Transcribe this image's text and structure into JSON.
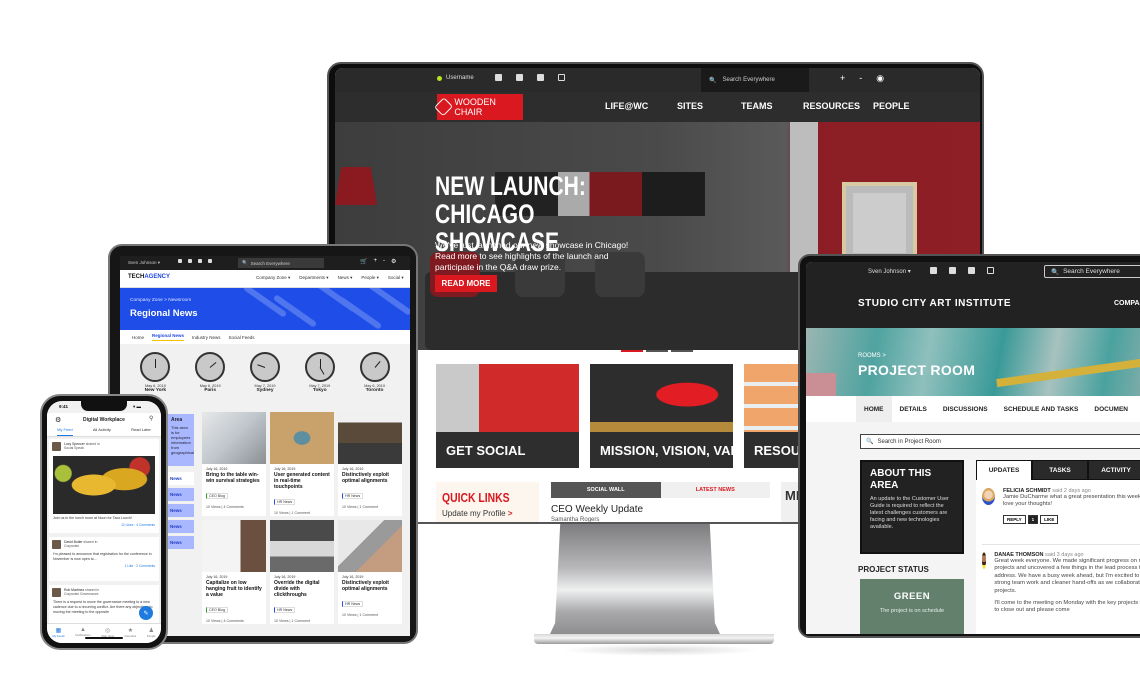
{
  "desktop": {
    "topbar": {
      "username": "Username",
      "search_placeholder": "Search Everywhere",
      "icons": [
        "chat-icon",
        "task-icon",
        "calendar-icon",
        "compose-icon"
      ],
      "right_icons": [
        "+",
        "-",
        "settings"
      ]
    },
    "nav": {
      "logo": "WOODEN CHAIR",
      "items": [
        "LIFE@WC",
        "SITES",
        "TEAMS",
        "RESOURCES",
        "PEOPLE"
      ]
    },
    "hero": {
      "title_line1": "NEW LAUNCH:",
      "title_line2": "CHICAGO SHOWCASE",
      "text": "We've just launched our new showcase in Chicago! Read more to see highlights of the launch and participate in the Q&A draw prize.",
      "button": "READ MORE",
      "slides": 3,
      "active_slide": 1
    },
    "tiles": [
      "GET SOCIAL",
      "MISSION, VISION, VALUES",
      "RESOURCES"
    ],
    "quick_links": {
      "title": "QUICK LINKS",
      "link": "Update my Profile",
      "arrow": ">"
    },
    "social_tabs": [
      "SOCIAL WALL",
      "LATEST NEWS"
    ],
    "post": {
      "title": "CEO Weekly Update",
      "author": "Samantha Rogers"
    },
    "side_box_title": "ME"
  },
  "laptop": {
    "topbar": {
      "user": "Sven Johnson ▾",
      "search_placeholder": "Search Everywhere"
    },
    "brand": "STUDIO CITY ART INSTITUTE",
    "nav_right": "COMPAN",
    "breadcrumb": "ROOMS >",
    "room_title": "PROJECT ROOM",
    "tabs": [
      "HOME",
      "DETAILS",
      "DISCUSSIONS",
      "SCHEDULE AND TASKS",
      "DOCUMEN"
    ],
    "room_search_placeholder": "Search in Project Room",
    "about": {
      "title": "ABOUT THIS AREA",
      "text": "An update to the Customer User Guide is required to reflect the latest challenges customers are facing and new technologies available."
    },
    "status": {
      "heading": "PROJECT STATUS",
      "value": "GREEN",
      "text": "The project is on schedule",
      "color": "#63806d"
    },
    "panel_tabs": [
      "UPDATES",
      "TASKS",
      "ACTIVITY"
    ],
    "posts": [
      {
        "name": "FELICIA SCHMIDT",
        "when": "said 2 days ago",
        "text": "Jamie DuCharme what a great presentation this week! Would love your thoughts!",
        "reply": "REPLY",
        "likes": "1",
        "like": "LIKE"
      },
      {
        "name": "DANAE THOMSON",
        "when": "said 3 days ago",
        "text": "Great week everyone. We made significant progress on many projects and uncovered a few things in the lead process to address. We have a busy week ahead, but I'm excited to see the strong team work and cleaner hand-offs as we collaborate on projects.",
        "text2": "I'll come to the meeting on Monday with the key projects we need to close out and please come"
      }
    ]
  },
  "tablet": {
    "topbar": {
      "user": "Sven Johnson ▾",
      "search_placeholder": "Search Everywhere"
    },
    "logo_a": "TECH",
    "logo_b": "AGENCY",
    "nav": [
      "Company Zone ▾",
      "Departments ▾",
      "News ▾",
      "People ▾",
      "Social ▾"
    ],
    "breadcrumb": "Company Zone > Newsroom",
    "title": "Regional News",
    "subnav": [
      "Home",
      "Regional News",
      "Industry News",
      "Social Feeds"
    ],
    "subnav_active": 1,
    "clocks": [
      {
        "date": "May 6, 2019",
        "city": "New York"
      },
      {
        "date": "May 6, 2019",
        "city": "Paris"
      },
      {
        "date": "May 7, 2019",
        "city": "Sydney"
      },
      {
        "date": "May 7, 2019",
        "city": "Tokyo"
      },
      {
        "date": "May 6, 2019",
        "city": "Toronto"
      }
    ],
    "side_box": {
      "title": "Area",
      "text": "This area is for employees information from geographical"
    },
    "side_items": [
      "News",
      "News",
      "News",
      "News",
      "News"
    ],
    "cards": [
      {
        "date": "July 16, 2019",
        "title": "Bring to the table win-win survival strategies",
        "tag": "CEO Blog",
        "meta": "10 Views | 4 Comments"
      },
      {
        "date": "July 16, 2019",
        "title": "User generated content in real-time touchpoints",
        "tag": "HR News",
        "meta": "10 Views | 1 Comment"
      },
      {
        "date": "July 16, 2019",
        "title": "Distinctively exploit optimal alignments",
        "tag": "HR News",
        "meta": "10 Views | 1 Comment"
      },
      {
        "date": "July 16, 2019",
        "title": "Capitalize on low hanging fruit to identify a value",
        "tag": "CEO Blog",
        "meta": "10 Views | 4 Comments"
      },
      {
        "date": "July 16, 2019",
        "title": "Override the digital divide with clickthroughs",
        "tag": "HR News",
        "meta": "10 Views | 1 Comment"
      },
      {
        "date": "July 16, 2019",
        "title": "Distinctively exploit optimal alignments",
        "tag": "HR News",
        "meta": "10 Views | 1 Comment"
      }
    ]
  },
  "phone": {
    "time": "9:41",
    "status": "▾ ▬",
    "title": "Digital Workplace",
    "tabs": [
      "My Feed",
      "All Activity",
      "Read Later"
    ],
    "posts": [
      {
        "author": "Lucy Spencer",
        "action": "shared in",
        "space": "Social Speak",
        "text": "Join us in the lunch room at Noon for Taco Lunch!",
        "meta": "12 Likes · 4 Comments"
      },
      {
        "author": "David Butler",
        "action": "shared in",
        "space": "Corporate",
        "text": "I'm pleased to announce that registration for the conference in November is now open to...",
        "meta": "1 Like · 2 Comments"
      },
      {
        "author": "Rob Martinez",
        "action": "shared in",
        "space": "Corporate Governance",
        "text": "There is a request to move the governance meeting to a new cadence due to a recurring conflict. Are there any objections to moving the meeting to the opposite"
      }
    ],
    "bottom_nav": [
      "My Feeds",
      "Notifications",
      "Web View",
      "Favorites",
      "People"
    ]
  }
}
